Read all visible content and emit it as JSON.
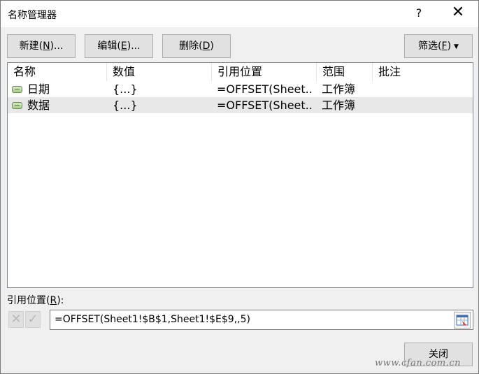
{
  "window": {
    "title": "名称管理器",
    "help_label": "?",
    "close_label": "✕"
  },
  "toolbar": {
    "new_label": "新建",
    "new_key": "N",
    "new_suffix": "...",
    "edit_label": "编辑",
    "edit_key": "E",
    "edit_suffix": "...",
    "delete_label": "删除",
    "delete_key": "D",
    "filter_label": "筛选",
    "filter_key": "F"
  },
  "list": {
    "columns": [
      "名称",
      "数值",
      "引用位置",
      "范围",
      "批注"
    ],
    "rows": [
      {
        "name": "日期",
        "value": "{...}",
        "ref": "=OFFSET(Sheet...",
        "scope": "工作簿",
        "comment": ""
      },
      {
        "name": "数据",
        "value": "{...}",
        "ref": "=OFFSET(Sheet...",
        "scope": "工作簿",
        "comment": ""
      }
    ]
  },
  "reference": {
    "label": "引用位置",
    "key": "R",
    "value": "=OFFSET(Sheet1!$B$1,Sheet1!$E$9,,5)",
    "cancel_icon": "✕",
    "confirm_icon": "✓"
  },
  "footer": {
    "close_label": "关闭"
  },
  "watermark": "www.cfan.com.cn",
  "colors": {
    "dialog_bg": "#f0f0f0",
    "selected_row": "#e8e8e8",
    "button_bg": "#e1e1e1"
  }
}
